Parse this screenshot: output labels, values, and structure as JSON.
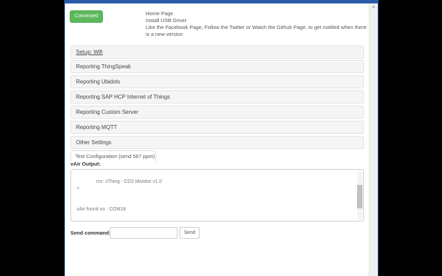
{
  "status_button": "Connected",
  "links": [
    "Home Page",
    "Install USB Driver",
    "Like the Facebook Page, Follow the Twitter or Watch the Github Page, to get notified when there is a new version"
  ],
  "panels": [
    "Setup: Wifi",
    "Reporting  ThingSpeak",
    "Reporting  Ubidots",
    "Reporting  SAP HCP Internet of Things",
    "Reporting  Custom Server",
    "Reporting  MQTT",
    "Other Settings"
  ],
  "test_tab": "Test Configuration (send 567 ppm)",
  "output_label": "vAir Output:",
  "output_lines": [
    "rcv: vThing - CO2 Monitor v1.0",
    ">",
    "vAir found on : COM18"
  ],
  "send_label": "Send command:",
  "send_value": "",
  "send_button": "Send"
}
